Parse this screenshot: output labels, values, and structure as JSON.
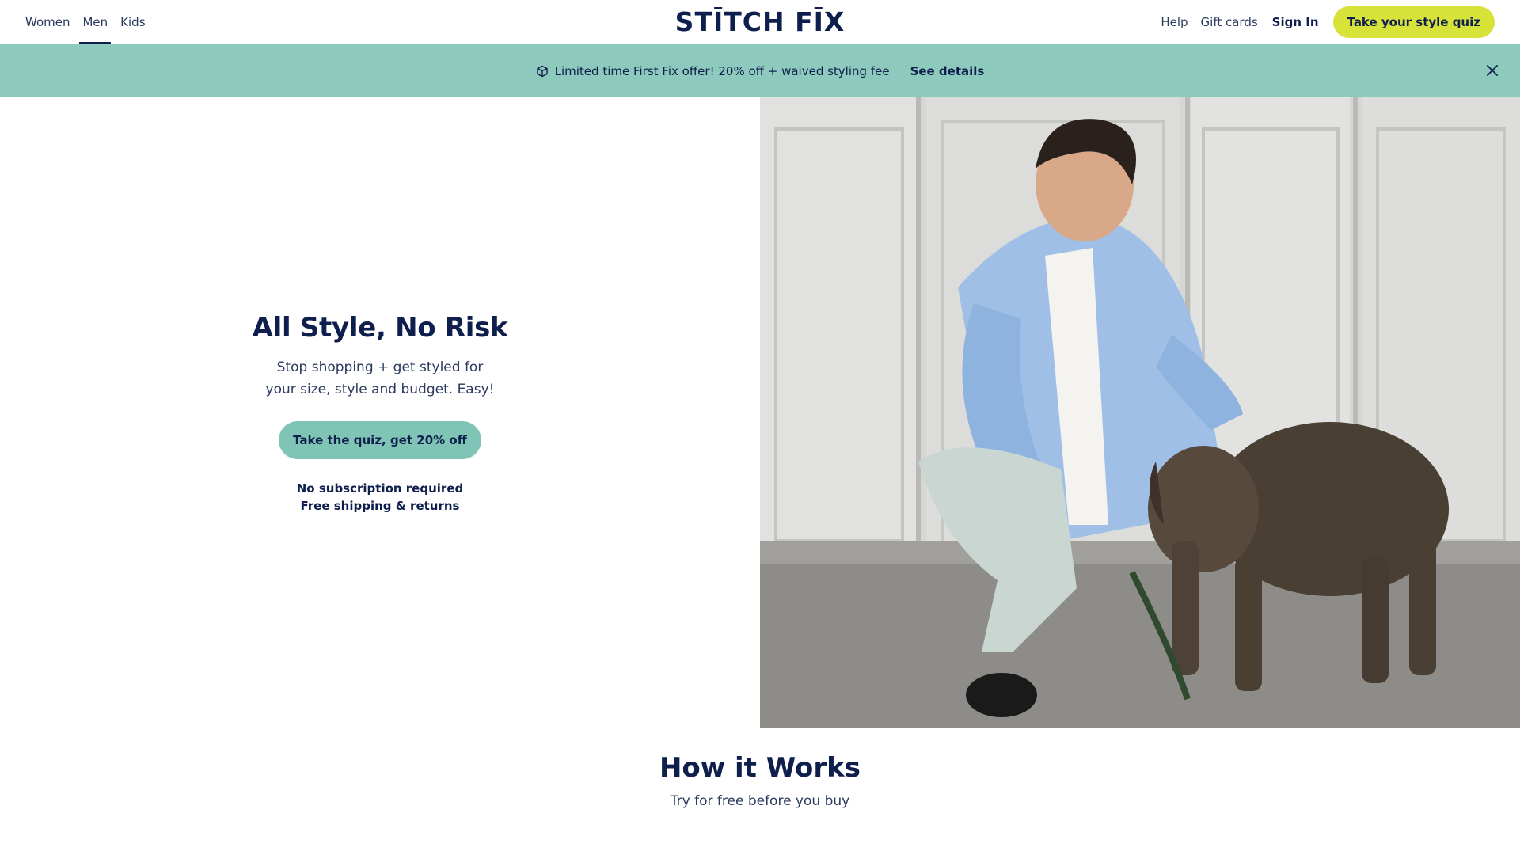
{
  "header": {
    "nav": [
      {
        "label": "Women",
        "active": false
      },
      {
        "label": "Men",
        "active": true
      },
      {
        "label": "Kids",
        "active": false
      }
    ],
    "logo": "STĪTCH FĪX",
    "help": "Help",
    "gift_cards": "Gift cards",
    "sign_in": "Sign In",
    "cta": "Take your style quiz",
    "cta_color": "#d8e33a"
  },
  "banner": {
    "icon": "box-icon",
    "text": "Limited time First Fix offer! 20% off + waived styling fee",
    "link": "See details",
    "close_icon": "close-icon",
    "background": "#8ec9bd"
  },
  "hero": {
    "title": "All Style, No Risk",
    "subtitle": "Stop shopping + get styled for your size, style and budget. Easy!",
    "cta": "Take the quiz, get 20% off",
    "notes": [
      "No subscription required",
      "Free shipping & returns"
    ],
    "image": "man-crouching-with-dog-photo"
  },
  "how_it_works": {
    "title": "How it Works",
    "subtitle": "Try for free before you buy"
  },
  "colors": {
    "navy": "#0f1f4d",
    "teal": "#7fc4b4"
  }
}
